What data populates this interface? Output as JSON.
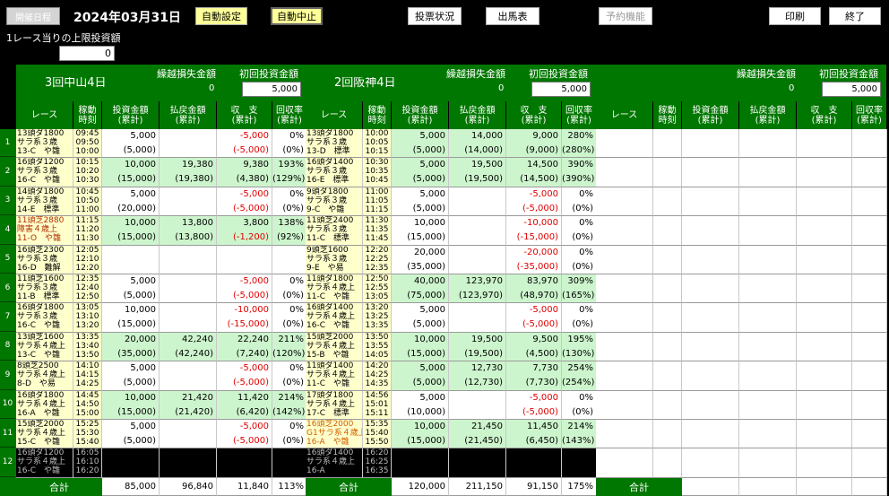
{
  "header": {
    "date_label": "開催日程",
    "date": "2024年03月31日",
    "auto_set": "自動設定",
    "auto_stop": "自動中止",
    "vote_status": "投票状況",
    "entries": "出馬表",
    "reserve": "予約機能",
    "print": "印刷",
    "end": "終了",
    "limit_label": "1レース当りの上限投資額",
    "limit_value": "0"
  },
  "colors": {
    "green": "#007700",
    "light_green": "#cdf5cd",
    "cream": "#ffffcc",
    "negative": "#e00000",
    "button_yellow": "#ffff99"
  },
  "labels": {
    "carry_loss": "繰越損失金額",
    "initial_invest": "初回投資金額"
  },
  "col_headers": [
    [
      "レース"
    ],
    [
      "稼動",
      "時刻"
    ],
    [
      "投資金額",
      "(累計)"
    ],
    [
      "払戻金額",
      "(累計)"
    ],
    [
      "収　支",
      "(累計)"
    ],
    [
      "回収率",
      "(累計)"
    ]
  ],
  "total_label": "合計",
  "row_numbers": [
    "1",
    "2",
    "3",
    "4",
    "5",
    "6",
    "7",
    "8",
    "9",
    "10",
    "11",
    "12"
  ],
  "venues": [
    {
      "name": "3回中山4日",
      "carry_loss": "0",
      "initial_invest": "5,000",
      "rows": [
        {
          "race": [
            "13頭ダ1800",
            "サラ系３歳",
            "13-C　や雛"
          ],
          "times": [
            "09:45",
            "09:50",
            "10:00"
          ],
          "invest": [
            "5,000",
            "(5,000)"
          ],
          "payout": [
            "",
            ""
          ],
          "profit": [
            "-5,000",
            "(-5,000)"
          ],
          "rate": [
            "0%",
            "(0%)"
          ],
          "bg": "w"
        },
        {
          "race": [
            "16頭ダ1200",
            "サラ系３歳",
            "16-C　や雛"
          ],
          "times": [
            "10:15",
            "10:20",
            "10:30"
          ],
          "invest": [
            "10,000",
            "(15,000)"
          ],
          "payout": [
            "19,380",
            "(19,380)"
          ],
          "profit": [
            "9,380",
            "(4,380)"
          ],
          "rate": [
            "193%",
            "(129%)"
          ],
          "bg": "lg"
        },
        {
          "race": [
            "14頭ダ1800",
            "サラ系３歳",
            "14-E　標準"
          ],
          "times": [
            "10:45",
            "10:50",
            "11:00"
          ],
          "invest": [
            "5,000",
            "(20,000)"
          ],
          "payout": [
            "",
            ""
          ],
          "profit": [
            "-5,000",
            "(-5,000)"
          ],
          "rate": [
            "0%",
            "(0%)"
          ],
          "bg": "w"
        },
        {
          "race": [
            "11頭芝2880",
            "障害４歳上",
            "11-O　や雛"
          ],
          "times": [
            "11:15",
            "11:20",
            "11:30"
          ],
          "invest": [
            "10,000",
            "(15,000)"
          ],
          "payout": [
            "13,800",
            "(13,800)"
          ],
          "profit": [
            "3,800",
            "(-1,200)"
          ],
          "rate": [
            "138%",
            "(92%)"
          ],
          "bg": "lg",
          "race_color": "#b03000"
        },
        {
          "race": [
            "16頭芝2300",
            "サラ系３歳",
            "16-D　難解"
          ],
          "times": [
            "12:05",
            "12:10",
            "12:20"
          ],
          "invest": [
            "",
            ""
          ],
          "payout": [
            "",
            ""
          ],
          "profit": [
            "",
            ""
          ],
          "rate": [
            "",
            ""
          ],
          "bg": "w"
        },
        {
          "race": [
            "11頭芝1600",
            "サラ系３歳",
            "11-B　標準"
          ],
          "times": [
            "12:35",
            "12:40",
            "12:50"
          ],
          "invest": [
            "5,000",
            "(5,000)"
          ],
          "payout": [
            "",
            ""
          ],
          "profit": [
            "-5,000",
            "(-5,000)"
          ],
          "rate": [
            "0%",
            "(0%)"
          ],
          "bg": "w"
        },
        {
          "race": [
            "16頭ダ1800",
            "サラ系３歳",
            "16-C　や雛"
          ],
          "times": [
            "13:05",
            "13:10",
            "13:20"
          ],
          "invest": [
            "10,000",
            "(15,000)"
          ],
          "payout": [
            "",
            ""
          ],
          "profit": [
            "-10,000",
            "(-15,000)"
          ],
          "rate": [
            "0%",
            "(0%)"
          ],
          "bg": "w"
        },
        {
          "race": [
            "13頭芝1600",
            "サラ系４歳上",
            "13-C　や雛"
          ],
          "times": [
            "13:35",
            "13:40",
            "13:50"
          ],
          "invest": [
            "20,000",
            "(35,000)"
          ],
          "payout": [
            "42,240",
            "(42,240)"
          ],
          "profit": [
            "22,240",
            "(7,240)"
          ],
          "rate": [
            "211%",
            "(120%)"
          ],
          "bg": "lg"
        },
        {
          "race": [
            "8頭芝2500",
            "サラ系４歳上",
            "8-D　や易"
          ],
          "times": [
            "14:10",
            "14:15",
            "14:25"
          ],
          "invest": [
            "5,000",
            "(5,000)"
          ],
          "payout": [
            "",
            ""
          ],
          "profit": [
            "-5,000",
            "(-5,000)"
          ],
          "rate": [
            "0%",
            "(0%)"
          ],
          "bg": "w"
        },
        {
          "race": [
            "16頭ダ1800",
            "サラ系４歳上",
            "16-A　や雛"
          ],
          "times": [
            "14:45",
            "14:50",
            "15:00"
          ],
          "invest": [
            "10,000",
            "(15,000)"
          ],
          "payout": [
            "21,420",
            "(21,420)"
          ],
          "profit": [
            "11,420",
            "(6,420)"
          ],
          "rate": [
            "214%",
            "(142%)"
          ],
          "bg": "lg"
        },
        {
          "race": [
            "15頭芝2000",
            "サラ系４歳上",
            "15-C　や雛"
          ],
          "times": [
            "15:25",
            "15:30",
            "15:40"
          ],
          "invest": [
            "5,000",
            "(5,000)"
          ],
          "payout": [
            "",
            ""
          ],
          "profit": [
            "-5,000",
            "(-5,000)"
          ],
          "rate": [
            "0%",
            "(0%)"
          ],
          "bg": "w"
        },
        {
          "race": [
            "16頭ダ1200",
            "サラ系４歳上",
            "16-C　や雛"
          ],
          "times": [
            "16:05",
            "16:10",
            "16:20"
          ],
          "invest": [
            "",
            ""
          ],
          "payout": [
            "",
            ""
          ],
          "profit": [
            "",
            ""
          ],
          "rate": [
            "",
            ""
          ],
          "bg": "dim"
        }
      ],
      "totals": {
        "invest": "85,000",
        "payout": "96,840",
        "profit": "11,840",
        "rate": "113%"
      }
    },
    {
      "name": "2回阪神4日",
      "carry_loss": "0",
      "initial_invest": "5,000",
      "rows": [
        {
          "race": [
            "13頭ダ1800",
            "サラ系３歳",
            "13-D　標準"
          ],
          "times": [
            "10:00",
            "10:05",
            "10:15"
          ],
          "invest": [
            "5,000",
            "(5,000)"
          ],
          "payout": [
            "14,000",
            "(14,000)"
          ],
          "profit": [
            "9,000",
            "(9,000)"
          ],
          "rate": [
            "280%",
            "(280%)"
          ],
          "bg": "lg"
        },
        {
          "race": [
            "16頭ダ1400",
            "サラ系３歳",
            "16-E　標準"
          ],
          "times": [
            "10:30",
            "10:35",
            "10:45"
          ],
          "invest": [
            "5,000",
            "(5,000)"
          ],
          "payout": [
            "19,500",
            "(19,500)"
          ],
          "profit": [
            "14,500",
            "(14,500)"
          ],
          "rate": [
            "390%",
            "(390%)"
          ],
          "bg": "lg"
        },
        {
          "race": [
            "9頭ダ1800",
            "サラ系３歳",
            "9-C　や雛"
          ],
          "times": [
            "11:00",
            "11:05",
            "11:15"
          ],
          "invest": [
            "5,000",
            "(5,000)"
          ],
          "payout": [
            "",
            ""
          ],
          "profit": [
            "-5,000",
            "(-5,000)"
          ],
          "rate": [
            "0%",
            "(0%)"
          ],
          "bg": "w"
        },
        {
          "race": [
            "11頭芝2400",
            "サラ系３歳",
            "11-C　標準"
          ],
          "times": [
            "11:30",
            "11:35",
            "11:45"
          ],
          "invest": [
            "10,000",
            "(15,000)"
          ],
          "payout": [
            "",
            ""
          ],
          "profit": [
            "-10,000",
            "(-15,000)"
          ],
          "rate": [
            "0%",
            "(0%)"
          ],
          "bg": "w"
        },
        {
          "race": [
            "9頭芝1600",
            "サラ系３歳",
            "9-E　や易"
          ],
          "times": [
            "12:20",
            "12:25",
            "12:35"
          ],
          "invest": [
            "20,000",
            "(35,000)"
          ],
          "payout": [
            "",
            ""
          ],
          "profit": [
            "-20,000",
            "(-35,000)"
          ],
          "rate": [
            "0%",
            "(0%)"
          ],
          "bg": "w"
        },
        {
          "race": [
            "11頭ダ1800",
            "サラ系４歳上",
            "11-C　や雛"
          ],
          "times": [
            "12:50",
            "12:55",
            "13:05"
          ],
          "invest": [
            "40,000",
            "(75,000)"
          ],
          "payout": [
            "123,970",
            "(123,970)"
          ],
          "profit": [
            "83,970",
            "(48,970)"
          ],
          "rate": [
            "309%",
            "(165%)"
          ],
          "bg": "lg"
        },
        {
          "race": [
            "16頭ダ1400",
            "サラ系４歳上",
            "16-C　や雛"
          ],
          "times": [
            "13:20",
            "13:25",
            "13:35"
          ],
          "invest": [
            "5,000",
            "(5,000)"
          ],
          "payout": [
            "",
            ""
          ],
          "profit": [
            "-5,000",
            "(-5,000)"
          ],
          "rate": [
            "0%",
            "(0%)"
          ],
          "bg": "w"
        },
        {
          "race": [
            "15頭芝2000",
            "サラ系４歳上",
            "15-B　や雛"
          ],
          "times": [
            "13:50",
            "13:55",
            "14:05"
          ],
          "invest": [
            "10,000",
            "(15,000)"
          ],
          "payout": [
            "19,500",
            "(19,500)"
          ],
          "profit": [
            "9,500",
            "(4,500)"
          ],
          "rate": [
            "195%",
            "(130%)"
          ],
          "bg": "lg"
        },
        {
          "race": [
            "11頭ダ1400",
            "サラ系４歳上",
            "11-C　や雛"
          ],
          "times": [
            "14:20",
            "14:25",
            "14:35"
          ],
          "invest": [
            "5,000",
            "(5,000)"
          ],
          "payout": [
            "12,730",
            "(12,730)"
          ],
          "profit": [
            "7,730",
            "(7,730)"
          ],
          "rate": [
            "254%",
            "(254%)"
          ],
          "bg": "lg"
        },
        {
          "race": [
            "17頭ダ1800",
            "サラ系４歳上",
            "17-C　標準"
          ],
          "times": [
            "14:56",
            "15:01",
            "15:11"
          ],
          "invest": [
            "5,000",
            "(10,000)"
          ],
          "payout": [
            "",
            ""
          ],
          "profit": [
            "-5,000",
            "(-5,000)"
          ],
          "rate": [
            "0%",
            "(0%)"
          ],
          "bg": "w"
        },
        {
          "race": [
            "16頭芝2000",
            "G1サラ系４歳上",
            "16-A　や雛"
          ],
          "times": [
            "15:35",
            "15:40",
            "15:50"
          ],
          "invest": [
            "10,000",
            "(15,000)"
          ],
          "payout": [
            "21,450",
            "(21,450)"
          ],
          "profit": [
            "11,450",
            "(6,450)"
          ],
          "rate": [
            "214%",
            "(143%)"
          ],
          "bg": "lg",
          "race_color": "#d06000"
        },
        {
          "race": [
            "16頭ダ1400",
            "サラ系４歳上",
            "16-A"
          ],
          "times": [
            "16:20",
            "16:25",
            "16:35"
          ],
          "invest": [
            "",
            ""
          ],
          "payout": [
            "",
            ""
          ],
          "profit": [
            "",
            ""
          ],
          "rate": [
            "",
            ""
          ],
          "bg": "dim"
        }
      ],
      "totals": {
        "invest": "120,000",
        "payout": "211,150",
        "profit": "91,150",
        "rate": "175%"
      }
    },
    {
      "name": "",
      "carry_loss": "0",
      "initial_invest": "5,000",
      "rows": [],
      "totals": {
        "invest": "",
        "payout": "",
        "profit": "",
        "rate": ""
      }
    }
  ]
}
